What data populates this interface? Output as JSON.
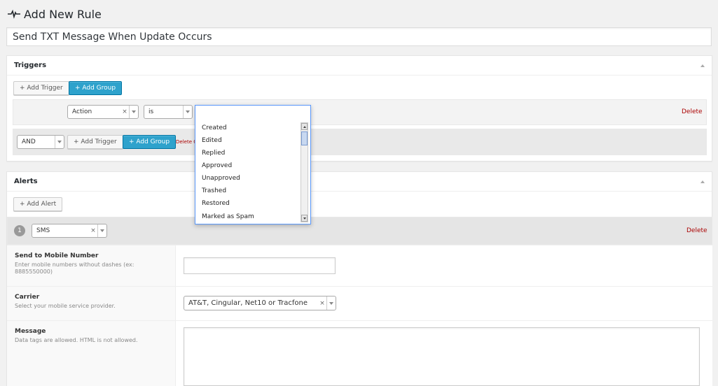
{
  "page": {
    "title": "Add New Rule",
    "icon": "pulse-icon"
  },
  "rule": {
    "name": "Send TXT Message When Update Occurs"
  },
  "triggers": {
    "title": "Triggers",
    "add_trigger_label": "+ Add Trigger",
    "add_group_label": "+ Add Group",
    "trigger_row": {
      "field_value": "Action",
      "operator_value": "is",
      "delete_label": "Delete"
    },
    "group_row": {
      "logic_value": "AND",
      "add_trigger_label": "+ Add Trigger",
      "add_group_label": "+ Add Group",
      "delete_group_label": "Delete G"
    },
    "dropdown": {
      "options": [
        "Created",
        "Edited",
        "Replied",
        "Approved",
        "Unapproved",
        "Trashed",
        "Restored",
        "Marked as Spam"
      ]
    }
  },
  "alerts": {
    "title": "Alerts",
    "add_alert_label": "+ Add Alert",
    "alert_number": "1",
    "alert_type_value": "SMS",
    "delete_label": "Delete",
    "fields": {
      "mobile": {
        "label": "Send to Mobile Number",
        "desc": "Enter mobile numbers without dashes (ex: 8885550000)",
        "value": ""
      },
      "carrier": {
        "label": "Carrier",
        "desc": "Select your mobile service provider.",
        "value": "AT&T, Cingular, Net10 or Tracfone"
      },
      "message": {
        "label": "Message",
        "desc": "Data tags are allowed. HTML is not allowed.",
        "value": ""
      }
    }
  },
  "colors": {
    "primary": "#2ea2cc",
    "delete": "#aa0000",
    "focus": "#5897fb"
  }
}
